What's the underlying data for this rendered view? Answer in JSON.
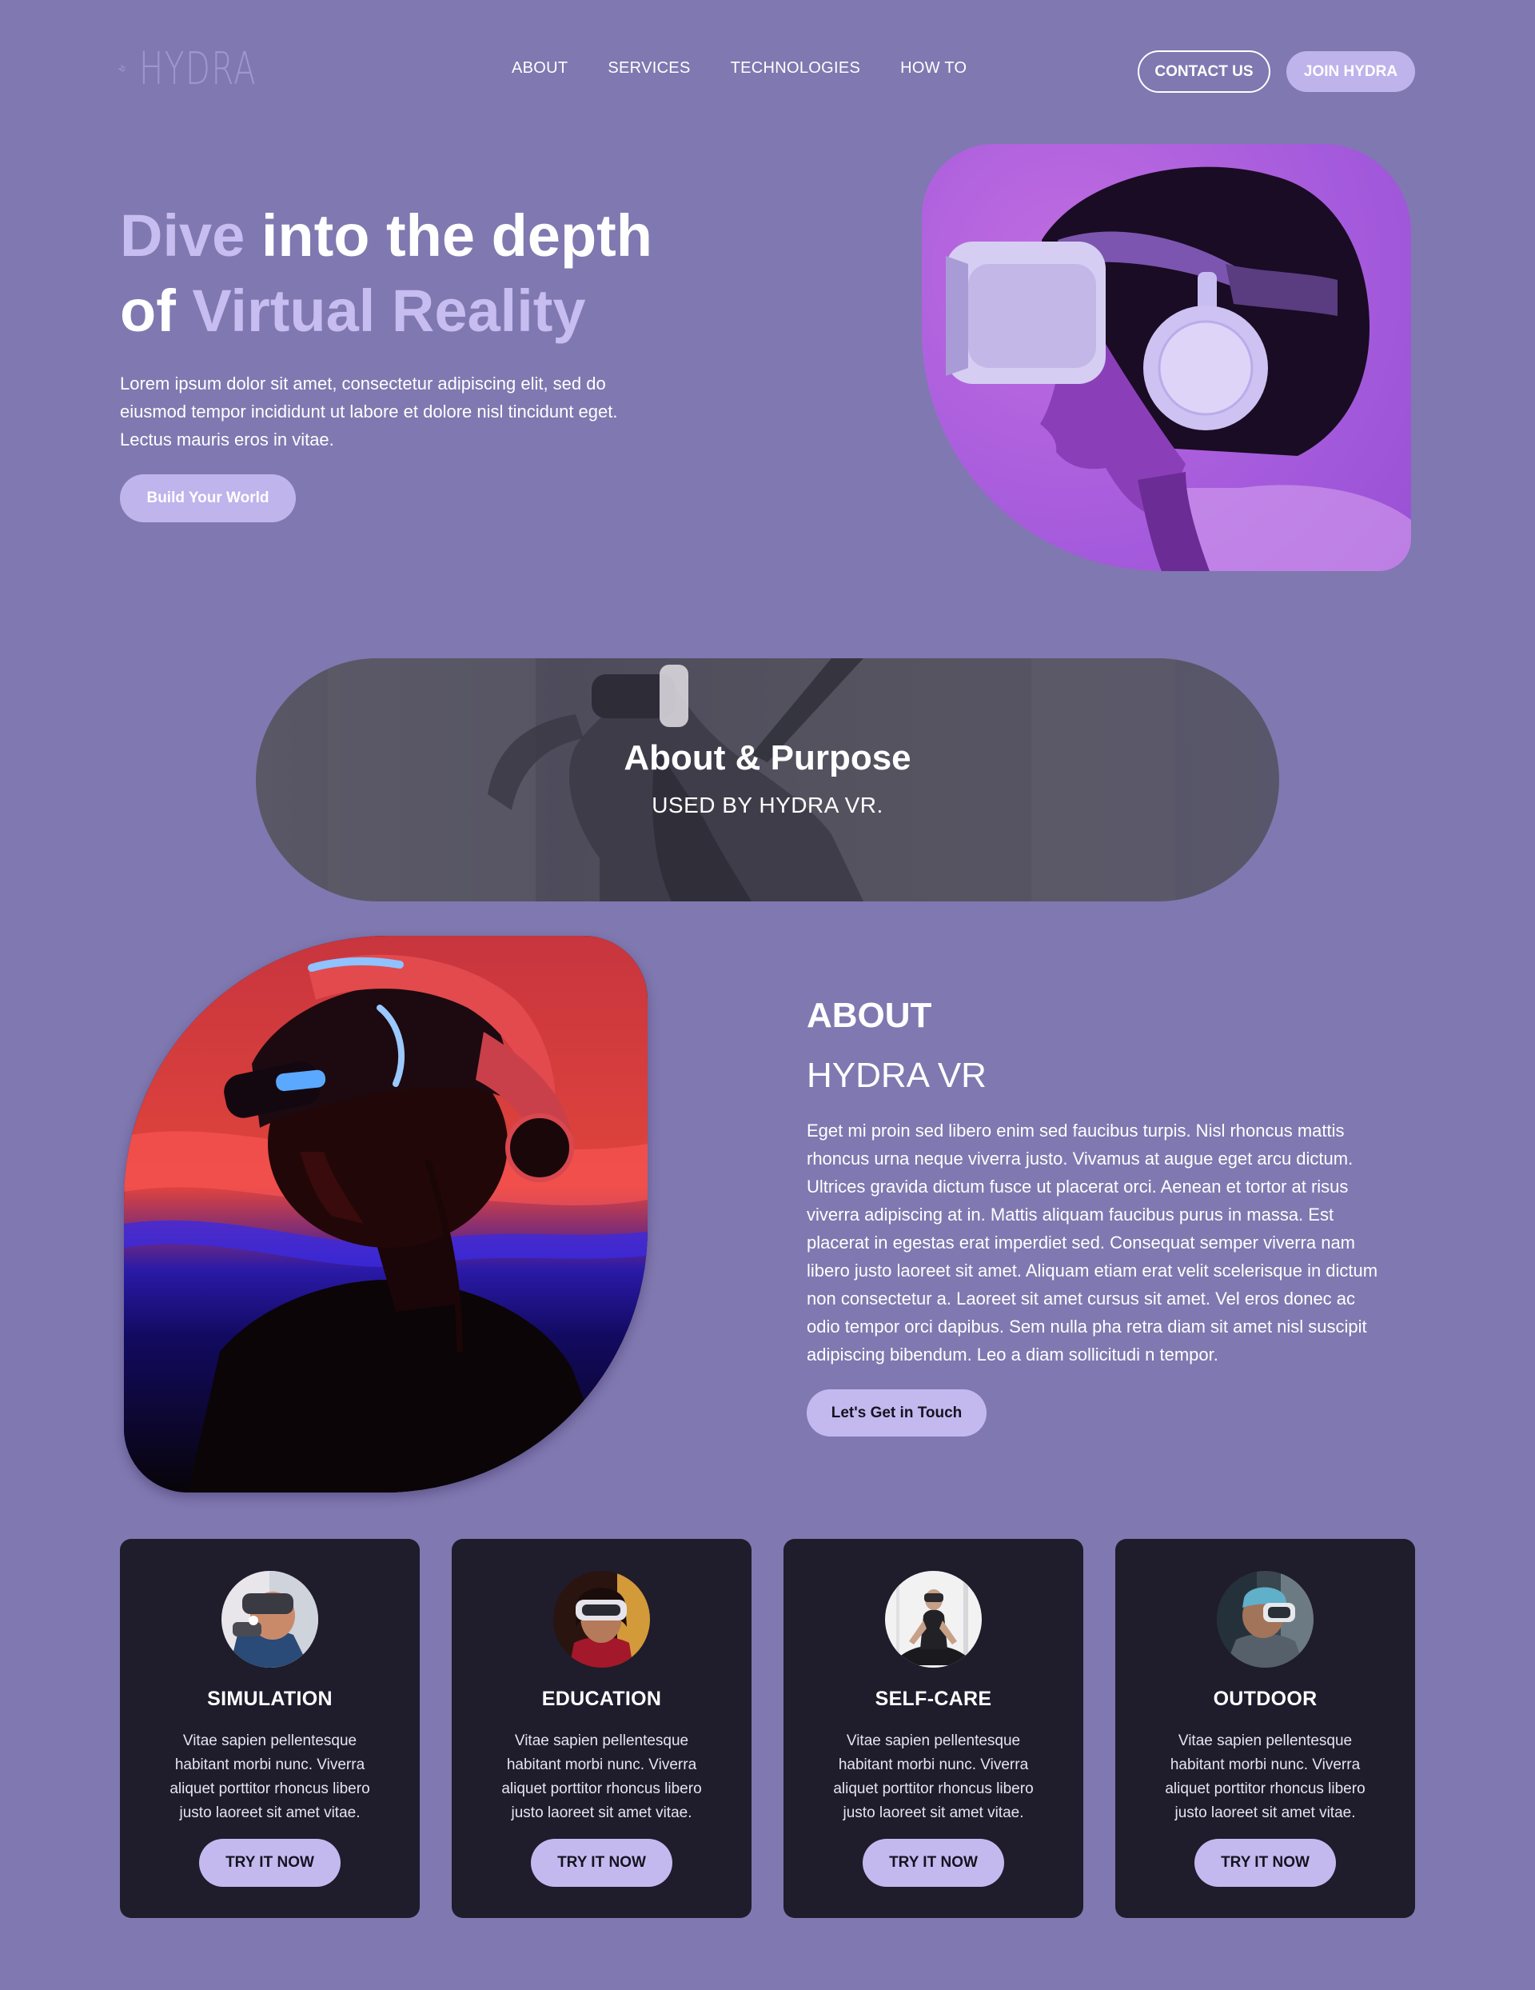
{
  "brand": {
    "name": "HYDRA"
  },
  "nav": {
    "links": [
      "ABOUT",
      "SERVICES",
      "TECHNOLOGIES",
      "HOW TO"
    ],
    "contact_label": "CONTACT US",
    "join_label": "JOIN HYDRA"
  },
  "hero": {
    "title_part1_accent": "Dive",
    "title_part2": " into the depth",
    "title_part3": "of ",
    "title_part4_accent": "Virtual Reality",
    "body": "Lorem ipsum dolor sit amet, consectetur adipiscing elit, sed do eiusmod tempor incididunt ut labore et dolore nisl tincidunt eget. Lectus mauris eros in vitae.",
    "cta_label": "Build Your World"
  },
  "banner": {
    "title": "About & Purpose",
    "subtitle": "USED BY HYDRA VR."
  },
  "about": {
    "heading": "ABOUT",
    "subheading": "HYDRA VR",
    "body": "Eget mi proin sed libero enim sed faucibus turpis. Nisl rhoncus mattis rhoncus urna neque viverra justo. Vivamus at augue eget arcu dictum. Ultrices gravida dictum fusce ut placerat orci. Aenean et tortor at risus viverra adipiscing at in. Mattis aliquam faucibus purus in massa. Est placerat in egestas erat imperdiet sed. Consequat semper viverra nam libero justo laoreet sit amet. Aliquam etiam erat velit scelerisque in dictum non consectetur a. Laoreet sit amet cursus sit amet. Vel eros donec ac odio tempor orci dapibus. Sem nulla pha retra diam sit amet nisl suscipit adipiscing bibendum. Leo a diam sollicitudi n tempor.",
    "cta_label": "Let's Get in Touch"
  },
  "cards": [
    {
      "title": "SIMULATION",
      "text": "Vitae sapien pellentesque habitant morbi nunc. Viverra aliquet porttitor rhoncus libero justo laoreet sit amet vitae.",
      "button": "TRY IT NOW"
    },
    {
      "title": "EDUCATION",
      "text": "Vitae sapien pellentesque habitant morbi nunc. Viverra aliquet porttitor rhoncus libero justo laoreet sit amet vitae.",
      "button": "TRY IT NOW"
    },
    {
      "title": "SELF-CARE",
      "text": "Vitae sapien pellentesque habitant morbi nunc. Viverra aliquet porttitor rhoncus libero justo laoreet sit amet vitae.",
      "button": "TRY IT NOW"
    },
    {
      "title": "OUTDOOR",
      "text": "Vitae sapien pellentesque habitant morbi nunc. Viverra aliquet porttitor rhoncus libero justo laoreet sit amet vitae.",
      "button": "TRY IT NOW"
    }
  ],
  "colors": {
    "page_background": "#8078b0",
    "accent_lavender": "#c4b9ef",
    "card_background": "#1f1c2c",
    "banner_background": "#55535f",
    "hero_image_background": "#a55bdc"
  },
  "icons": {
    "logo": "hydra-serpent-logo-icon"
  }
}
